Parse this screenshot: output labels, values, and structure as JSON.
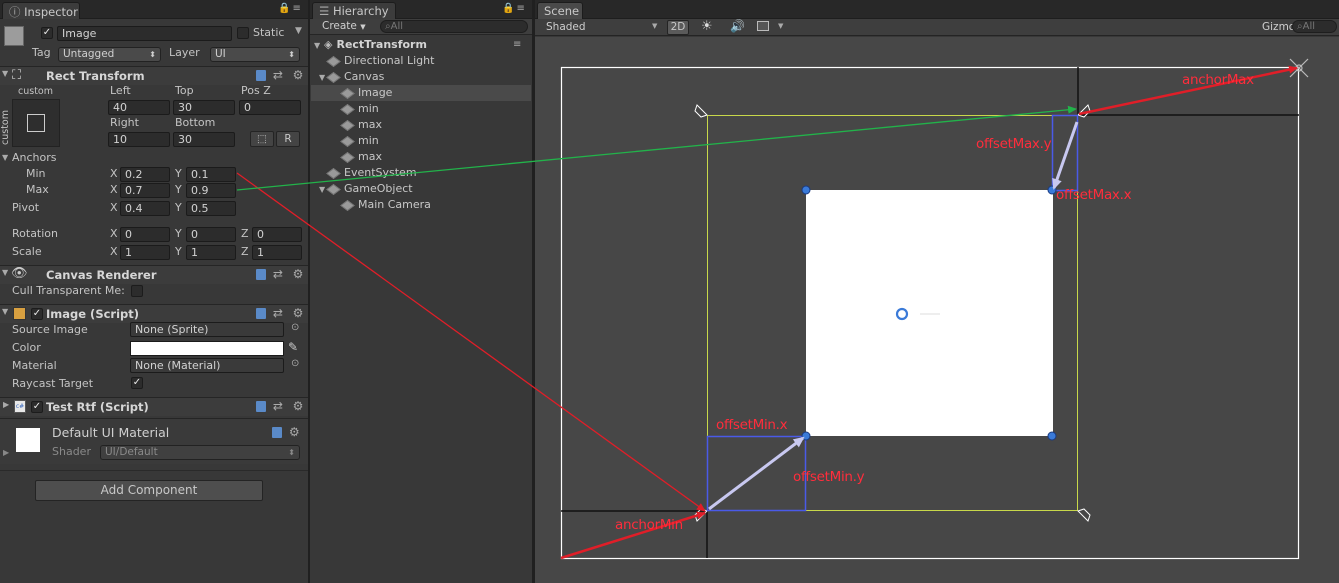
{
  "inspector": {
    "tab": "Inspector",
    "object_name": "Image",
    "static_label": "Static",
    "tag_label": "Tag",
    "tag_value": "Untagged",
    "layer_label": "Layer",
    "layer_value": "UI",
    "rect_transform": {
      "title": "Rect Transform",
      "custom_label": "custom",
      "custom_side": "custom",
      "col1": "Left",
      "col2": "Top",
      "col3": "Pos Z",
      "left": "40",
      "top": "30",
      "posz": "0",
      "col4": "Right",
      "col5": "Bottom",
      "right": "10",
      "bottom": "30",
      "r_button": "R",
      "anchors_label": "Anchors",
      "min_label": "Min",
      "max_label": "Max",
      "min_x": "0.2",
      "min_y": "0.1",
      "max_x": "0.7",
      "max_y": "0.9",
      "pivot_label": "Pivot",
      "pivot_x": "0.4",
      "pivot_y": "0.5",
      "rotation_label": "Rotation",
      "rot_x": "0",
      "rot_y": "0",
      "rot_z": "0",
      "scale_label": "Scale",
      "scale_x": "1",
      "scale_y": "1",
      "scale_z": "1",
      "x": "X",
      "y": "Y",
      "z": "Z"
    },
    "canvas_renderer": {
      "title": "Canvas Renderer",
      "cull_label": "Cull Transparent Me:"
    },
    "image_script": {
      "title": "Image (Script)",
      "source_label": "Source Image",
      "source_value": "None (Sprite)",
      "color_label": "Color",
      "material_label": "Material",
      "material_value": "None (Material)",
      "raycast_label": "Raycast Target"
    },
    "test_rtf": {
      "title": "Test Rtf (Script)"
    },
    "material": {
      "name": "Default UI Material",
      "shader_label": "Shader",
      "shader_value": "UI/Default"
    },
    "add_component": "Add Component"
  },
  "hierarchy": {
    "tab": "Hierarchy",
    "create": "Create",
    "search_placeholder": "All",
    "scene_name": "RectTransform",
    "items": [
      {
        "label": "Directional Light",
        "depth": 1,
        "fold": false,
        "selected": false
      },
      {
        "label": "Canvas",
        "depth": 1,
        "fold": true,
        "selected": false
      },
      {
        "label": "Image",
        "depth": 2,
        "fold": false,
        "selected": true
      },
      {
        "label": "min",
        "depth": 2,
        "fold": false,
        "selected": false
      },
      {
        "label": "max",
        "depth": 2,
        "fold": false,
        "selected": false
      },
      {
        "label": "min",
        "depth": 2,
        "fold": false,
        "selected": false
      },
      {
        "label": "max",
        "depth": 2,
        "fold": false,
        "selected": false
      },
      {
        "label": "EventSystem",
        "depth": 1,
        "fold": false,
        "selected": false
      },
      {
        "label": "GameObject",
        "depth": 1,
        "fold": true,
        "selected": false
      },
      {
        "label": "Main Camera",
        "depth": 2,
        "fold": false,
        "selected": false
      }
    ]
  },
  "scene": {
    "tab": "Scene",
    "shading": "Shaded",
    "mode_2d": "2D",
    "gizmos": "Gizmos",
    "search_placeholder": "All",
    "annotations": {
      "anchor_max": "anchorMax",
      "anchor_min": "anchorMin",
      "offset_max_y": "offsetMax.y",
      "offset_max_x": "offsetMax.x",
      "offset_min_x": "offsetMin.x",
      "offset_min_y": "offsetMin.y"
    }
  },
  "colors": {
    "panel_bg": "#383838",
    "scene_bg": "#464646",
    "annotation_red": "#ff2d3c",
    "arrow_red": "#e01e28",
    "arrow_green": "#22b34a",
    "anchor_yellow": "#c8d84a",
    "offset_blue": "#4a5ae8",
    "offset_arrow": "#c8c8f0"
  }
}
